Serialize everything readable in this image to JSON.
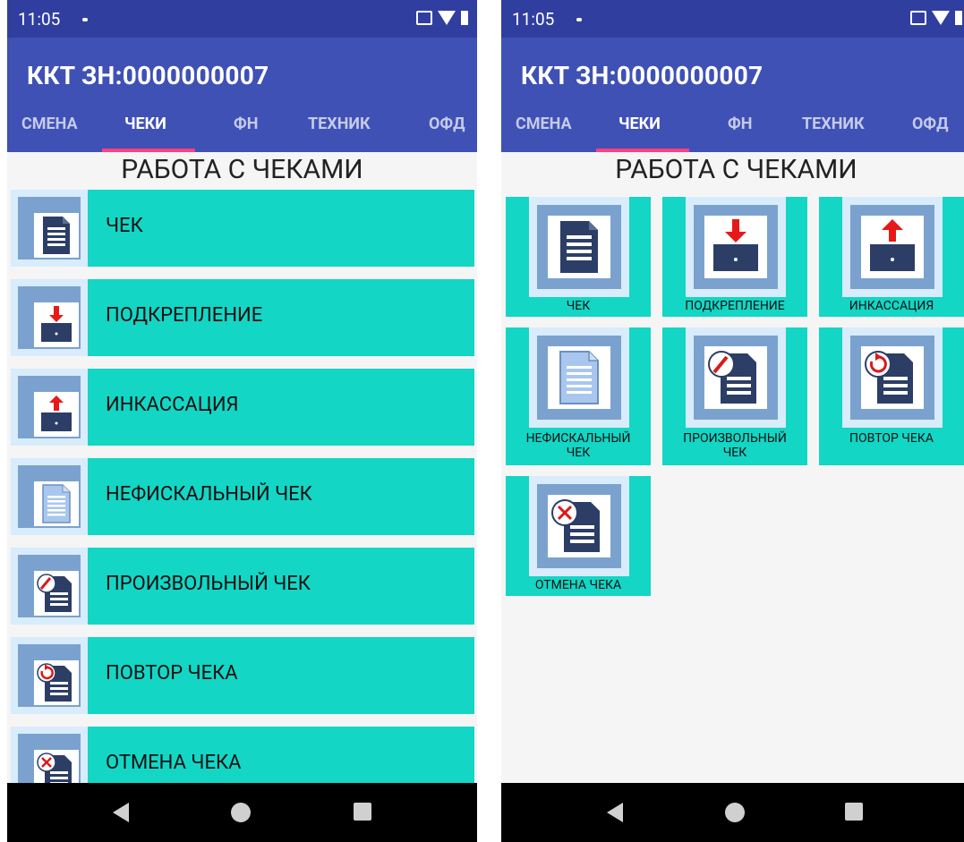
{
  "status": {
    "time": "11:05"
  },
  "app": {
    "title": "ККТ ЗН:0000000007"
  },
  "tabs": [
    "СМЕНА",
    "ЧЕКИ",
    "ФН",
    "ТЕХНИК",
    "ОФД"
  ],
  "active_tab": "ЧЕКИ",
  "heading": "РАБОТА С ЧЕКАМИ",
  "items": [
    {
      "label": "ЧЕК",
      "icon": "receipt-icon"
    },
    {
      "label": "ПОДКРЕПЛЕНИЕ",
      "icon": "cash-in-icon"
    },
    {
      "label": "ИНКАССАЦИЯ",
      "icon": "cash-out-icon"
    },
    {
      "label": "НЕФИСКАЛЬНЫЙ ЧЕК",
      "icon": "nonfiscal-receipt-icon"
    },
    {
      "label": "ПРОИЗВОЛЬНЫЙ ЧЕК",
      "icon": "custom-receipt-icon"
    },
    {
      "label": "ПОВТОР ЧЕКА",
      "icon": "repeat-receipt-icon"
    },
    {
      "label": "ОТМЕНА ЧЕКА",
      "icon": "cancel-receipt-icon"
    }
  ],
  "grid_labels": [
    [
      "ЧЕК"
    ],
    [
      "ПОДКРЕПЛЕНИЕ"
    ],
    [
      "ИНКАССАЦИЯ"
    ],
    [
      "НЕФИСКАЛЬНЫЙ",
      "ЧЕК"
    ],
    [
      "ПРОИЗВОЛЬНЫЙ",
      "ЧЕК"
    ],
    [
      "ПОВТОР ЧЕКА"
    ],
    [
      "ОТМЕНА ЧЕКА"
    ]
  ],
  "colors": {
    "appbar": "#3f51b5",
    "statusbar": "#303f9f",
    "tile": "#13d6c5",
    "indicator": "#ff4081",
    "icon_dark": "#2c3e66"
  }
}
